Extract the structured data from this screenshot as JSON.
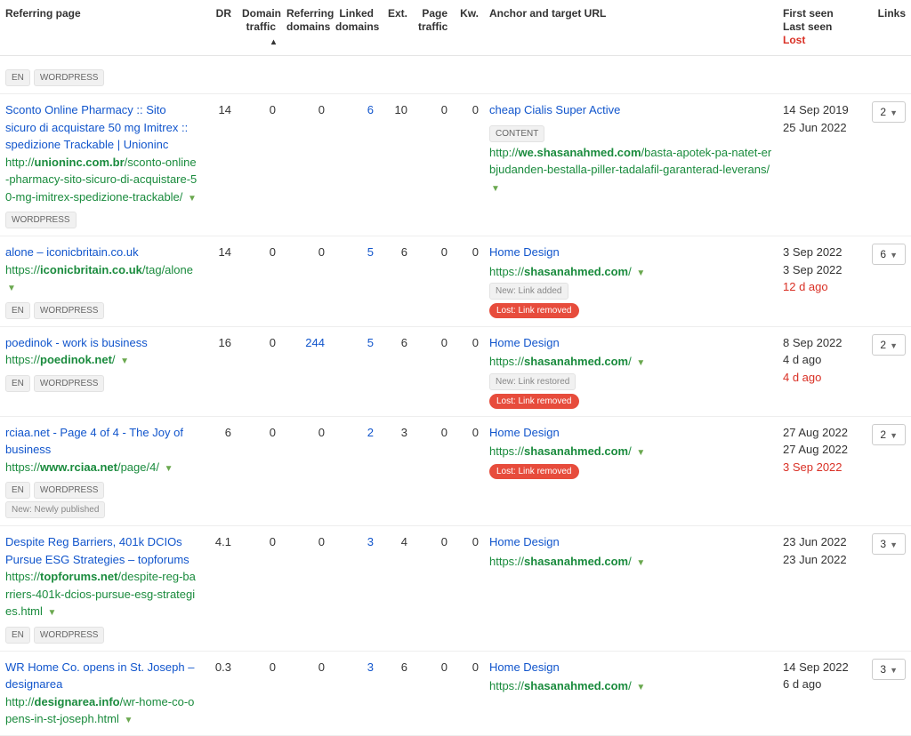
{
  "headers": {
    "referring_page": "Referring page",
    "dr": "DR",
    "domain_traffic": "Domain traffic",
    "referring_domains": "Referring domains",
    "linked_domains": "Linked domains",
    "ext": "Ext.",
    "page_traffic": "Page traffic",
    "kw": "Kw.",
    "anchor_target": "Anchor and target URL",
    "first_seen": "First seen",
    "last_seen": "Last seen",
    "lost": "Lost",
    "links": "Links"
  },
  "rows": [
    {
      "title": "Sconto Online Pharmacy :: Sito sicuro di acquistare 50 mg Imitrex :: spedizione Trackable | Unioninc",
      "url_prefix": "http://",
      "url_domain": "unioninc.com.br",
      "url_path": "/sconto-online-pharmacy-sito-sicuro-di-acquistare-50-mg-imitrex-spedizione-trackable/",
      "page_tags": [
        "WORDPRESS"
      ],
      "page_tags_lower": [],
      "dr": "14",
      "domain_traffic": "0",
      "referring_domains": "0",
      "linked_domains": "6",
      "ext": "10",
      "page_traffic": "0",
      "kw": "0",
      "anchor_text": "cheap Cialis Super Active",
      "anchor_tags": [
        "CONTENT"
      ],
      "anchor_url_prefix": "http://",
      "anchor_url_domain": "we.shasanahmed.com",
      "anchor_url_path": "/basta-apotek-pa-natet-erbjudanden-bestalla-piller-tadalafil-garanterad-leverans/",
      "pills": [],
      "grey_pill": "",
      "first_seen": "14 Sep 2019",
      "last_seen": "25 Jun 2022",
      "lost_text": "",
      "links": "2"
    },
    {
      "title": "alone – iconicbritain.co.uk",
      "url_prefix": "https://",
      "url_domain": "iconicbritain.co.uk",
      "url_path": "/tag/alone",
      "page_tags": [
        "EN",
        "WORDPRESS"
      ],
      "page_tags_lower": [],
      "dr": "14",
      "domain_traffic": "0",
      "referring_domains": "0",
      "linked_domains": "5",
      "ext": "6",
      "page_traffic": "0",
      "kw": "0",
      "anchor_text": "Home Design",
      "anchor_tags": [],
      "anchor_url_prefix": "https://",
      "anchor_url_domain": "shasanahmed.com",
      "anchor_url_path": "/",
      "grey_pill": "New: Link added",
      "pills": [
        "Lost: Link removed"
      ],
      "first_seen": "3 Sep 2022",
      "last_seen": "3 Sep 2022",
      "lost_text": "12 d ago",
      "links": "6"
    },
    {
      "title": "poedinok - work is business",
      "url_prefix": "https://",
      "url_domain": "poedinok.net",
      "url_path": "/",
      "page_tags": [
        "EN",
        "WORDPRESS"
      ],
      "page_tags_lower": [],
      "dr": "16",
      "domain_traffic": "0",
      "referring_domains": "244",
      "linked_domains": "5",
      "ext": "6",
      "page_traffic": "0",
      "kw": "0",
      "anchor_text": "Home Design",
      "anchor_tags": [],
      "anchor_url_prefix": "https://",
      "anchor_url_domain": "shasanahmed.com",
      "anchor_url_path": "/",
      "grey_pill": "New: Link restored",
      "pills": [
        "Lost: Link removed"
      ],
      "first_seen": "8 Sep 2022",
      "last_seen": "4 d ago",
      "lost_text": "4 d ago",
      "links": "2"
    },
    {
      "title": "rciaa.net - Page 4 of 4 - The Joy of business",
      "url_prefix": "https://",
      "url_domain": "www.rciaa.net",
      "url_path": "/page/4/",
      "page_tags": [
        "EN",
        "WORDPRESS"
      ],
      "page_tags_lower": [
        "New: Newly published"
      ],
      "dr": "6",
      "domain_traffic": "0",
      "referring_domains": "0",
      "linked_domains": "2",
      "ext": "3",
      "page_traffic": "0",
      "kw": "0",
      "anchor_text": "Home Design",
      "anchor_tags": [],
      "anchor_url_prefix": "https://",
      "anchor_url_domain": "shasanahmed.com",
      "anchor_url_path": "/",
      "grey_pill": "",
      "pills": [
        "Lost: Link removed"
      ],
      "first_seen": "27 Aug 2022",
      "last_seen": "27 Aug 2022",
      "lost_text": "3 Sep 2022",
      "links": "2"
    },
    {
      "title": "Despite Reg Barriers, 401k DCIOs Pursue ESG Strategies – topforums",
      "url_prefix": "https://",
      "url_domain": "topforums.net",
      "url_path": "/despite-reg-barriers-401k-dcios-pursue-esg-strategies.html",
      "page_tags": [
        "EN",
        "WORDPRESS"
      ],
      "page_tags_lower": [],
      "dr": "4.1",
      "domain_traffic": "0",
      "referring_domains": "0",
      "linked_domains": "3",
      "ext": "4",
      "page_traffic": "0",
      "kw": "0",
      "anchor_text": "Home Design",
      "anchor_tags": [],
      "anchor_url_prefix": "https://",
      "anchor_url_domain": "shasanahmed.com",
      "anchor_url_path": "/",
      "grey_pill": "",
      "pills": [],
      "first_seen": "23 Jun 2022",
      "last_seen": "23 Jun 2022",
      "lost_text": "",
      "links": "3"
    },
    {
      "title": "WR Home Co. opens in St. Joseph – designarea",
      "url_prefix": "http://",
      "url_domain": "designarea.info",
      "url_path": "/wr-home-co-opens-in-st-joseph.html",
      "page_tags": [],
      "page_tags_lower": [],
      "dr": "0.3",
      "domain_traffic": "0",
      "referring_domains": "0",
      "linked_domains": "3",
      "ext": "6",
      "page_traffic": "0",
      "kw": "0",
      "anchor_text": "Home Design",
      "anchor_tags": [],
      "anchor_url_prefix": "https://",
      "anchor_url_domain": "shasanahmed.com",
      "anchor_url_path": "/",
      "grey_pill": "",
      "pills": [],
      "first_seen": "14 Sep 2022",
      "last_seen": "6 d ago",
      "lost_text": "",
      "links": "3"
    }
  ],
  "partial_top_tags": [
    "EN",
    "WORDPRESS"
  ]
}
